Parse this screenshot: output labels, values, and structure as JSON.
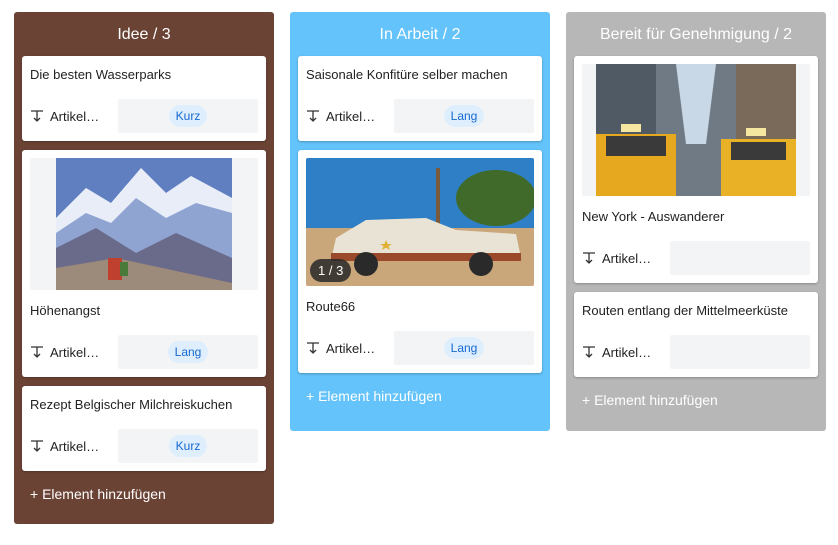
{
  "colors": {
    "col_idee": "#6b4335",
    "col_arbeit": "#63c3fa",
    "col_bereit": "#b7b7b7",
    "chip_bg": "#dfeefd",
    "chip_text": "#1769d1"
  },
  "columns": [
    {
      "title": "Idee / 3",
      "add_label": "+ Element hinzufügen",
      "cards": [
        {
          "title": "Die besten Wasserparks",
          "field_label": "Artikelg…",
          "value": "Kurz"
        },
        {
          "title": "Höhenangst",
          "field_label": "Artikelg…",
          "value": "Lang",
          "image": "mountain-photo"
        },
        {
          "title": "Rezept Belgischer Milchreiskuchen",
          "field_label": "Artikelg…",
          "value": "Kurz"
        }
      ]
    },
    {
      "title": "In Arbeit / 2",
      "add_label": "+ Element hinzufügen",
      "cards": [
        {
          "title": "Saisonale Konfitüre selber machen",
          "field_label": "Artikelg…",
          "value": "Lang"
        },
        {
          "title": "Route66",
          "field_label": "Artikelg…",
          "value": "Lang",
          "image": "car-photo",
          "image_counter": "1 / 3"
        }
      ]
    },
    {
      "title": "Bereit für Genehmigung / 2",
      "add_label": "+ Element hinzufügen",
      "cards": [
        {
          "title": "New York - Auswanderer",
          "field_label": "Artikelg…",
          "value": "",
          "image": "taxi-photo"
        },
        {
          "title": "Routen entlang der Mittelmeerküste",
          "field_label": "Artikelg…",
          "value": ""
        }
      ]
    }
  ]
}
